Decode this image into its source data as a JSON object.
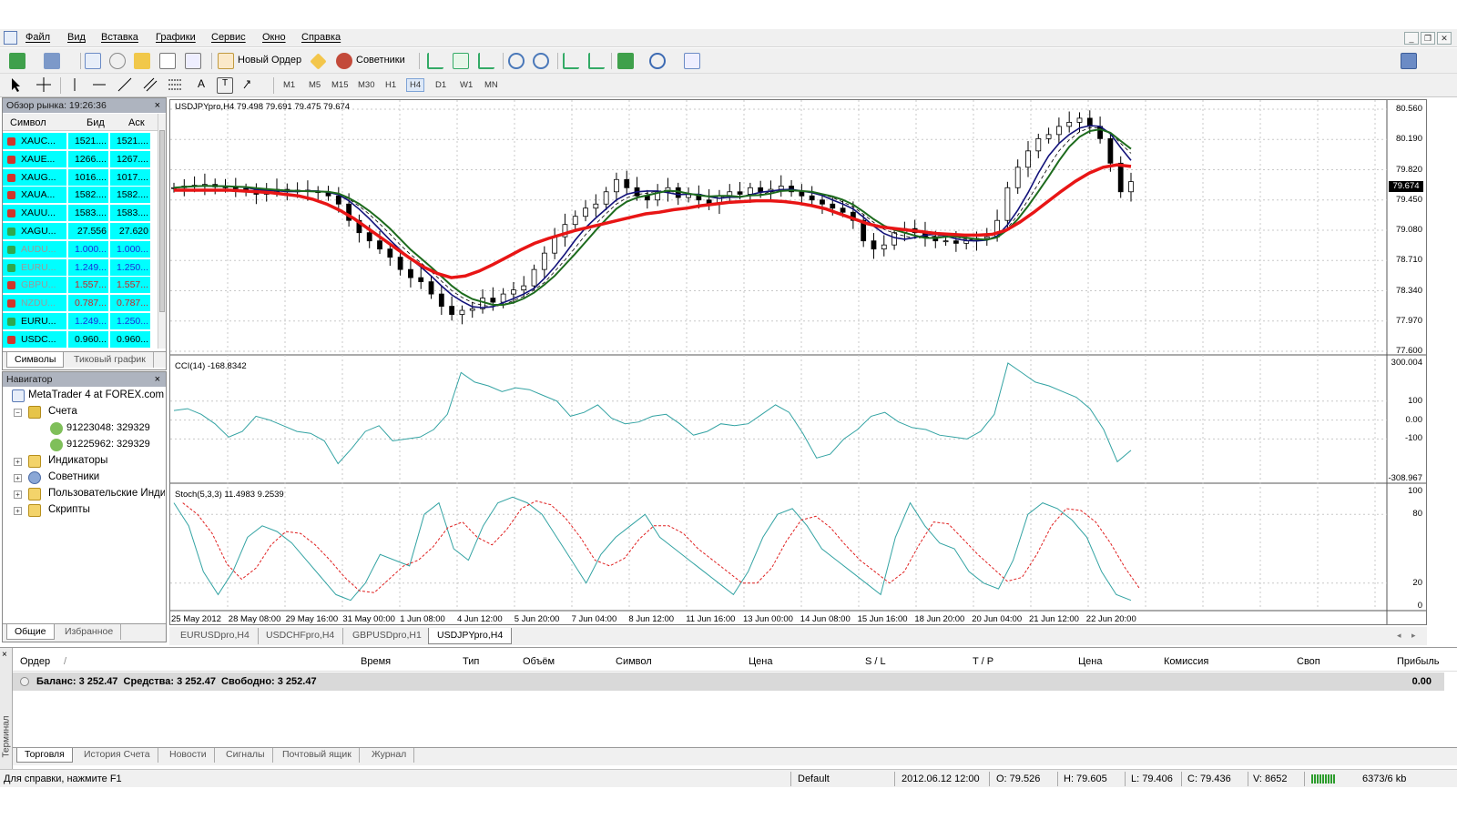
{
  "menu": [
    "Файл",
    "Вид",
    "Вставка",
    "Графики",
    "Сервис",
    "Окно",
    "Справка"
  ],
  "toolbar": {
    "new_order_label": "Новый Ордер",
    "experts_label": "Советники"
  },
  "timeframes": [
    "M1",
    "M5",
    "M15",
    "M30",
    "H1",
    "H4",
    "D1",
    "W1",
    "MN"
  ],
  "active_timeframe": "H4",
  "market_watch": {
    "title": "Обзор рынка: 19:26:36",
    "columns": [
      "Символ",
      "Бид",
      "Аск"
    ],
    "rows": [
      {
        "symbol": "XAUC...",
        "bid": "1521....",
        "ask": "1521....",
        "bg": "#00ffff",
        "dir": "down"
      },
      {
        "symbol": "XAUE...",
        "bid": "1266....",
        "ask": "1267....",
        "bg": "#00ffff",
        "dir": "down"
      },
      {
        "symbol": "XAUG...",
        "bid": "1016....",
        "ask": "1017....",
        "bg": "#00ffff",
        "dir": "down"
      },
      {
        "symbol": "XAUA...",
        "bid": "1582....",
        "ask": "1582....",
        "bg": "#00ffff",
        "dir": "down"
      },
      {
        "symbol": "XAUU...",
        "bid": "1583....",
        "ask": "1583....",
        "bg": "#00ffff",
        "dir": "down"
      },
      {
        "symbol": "XAGU...",
        "bid": "27.556",
        "ask": "27.620",
        "bg": "#00ffff",
        "dir": "up"
      },
      {
        "symbol": "AUDU...",
        "bid": "1.000...",
        "ask": "1.000...",
        "bg": "#00ffff",
        "dir": "up",
        "muted": true,
        "blue": true
      },
      {
        "symbol": "EURU...",
        "bid": "1.249...",
        "ask": "1.250...",
        "bg": "#00ffff",
        "dir": "up",
        "muted": true,
        "blue": true
      },
      {
        "symbol": "GBPU...",
        "bid": "1.557...",
        "ask": "1.557...",
        "bg": "#00ffff",
        "dir": "down",
        "muted": true,
        "red": true
      },
      {
        "symbol": "NZDU...",
        "bid": "0.787...",
        "ask": "0.787...",
        "bg": "#00ffff",
        "dir": "down",
        "muted": true,
        "red": true
      },
      {
        "symbol": "EURU...",
        "bid": "1.249...",
        "ask": "1.250...",
        "bg": "#00ffff",
        "dir": "up",
        "blue": true
      },
      {
        "symbol": "USDC...",
        "bid": "0.960...",
        "ask": "0.960...",
        "bg": "#00ffff",
        "dir": "down"
      }
    ],
    "tabs": [
      "Символы",
      "Тиковый график"
    ]
  },
  "navigator": {
    "title": "Навигатор",
    "root": "MetaTrader 4 at FOREX.com",
    "accounts_label": "Счета",
    "accounts": [
      "91223048: 329329",
      "91225962: 329329"
    ],
    "items": [
      "Индикаторы",
      "Советники",
      "Пользовательские Инди",
      "Скрипты"
    ],
    "tabs": [
      "Общие",
      "Избранное"
    ]
  },
  "chart": {
    "symbol_label": "USDJPYpro,H4  79.498 79.691 79.475 79.674",
    "current_price": "79.674",
    "price_ticks": [
      "80.560",
      "80.190",
      "79.820",
      "79.450",
      "79.080",
      "78.710",
      "78.340",
      "77.970",
      "77.600"
    ],
    "cci_label": "CCI(14) -168.8342",
    "cci_ticks": [
      "300.004",
      "100",
      "0.00",
      "-100",
      "-308.967"
    ],
    "stoch_label": "Stoch(5,3,3) 11.4983 9.2539",
    "stoch_ticks": [
      "100",
      "80",
      "20",
      "0"
    ],
    "dates": [
      "25 May 2012",
      "28 May 08:00",
      "29 May 16:00",
      "31 May 00:00",
      "1 Jun 08:00",
      "4 Jun 12:00",
      "5 Jun 20:00",
      "7 Jun 04:00",
      "8 Jun 12:00",
      "11 Jun 16:00",
      "13 Jun 00:00",
      "14 Jun 08:00",
      "15 Jun 16:00",
      "18 Jun 20:00",
      "20 Jun 04:00",
      "21 Jun 12:00",
      "22 Jun 20:00"
    ],
    "tabs": [
      "EURUSDpro,H4",
      "USDCHFpro,H4",
      "GBPUSDpro,H1",
      "USDJPYpro,H4"
    ],
    "active_tab": "USDJPYpro,H4"
  },
  "chart_data": {
    "type": "line",
    "title": "USDJPYpro,H4",
    "ylim": [
      77.6,
      80.56
    ],
    "close": [
      79.6,
      79.62,
      79.63,
      79.64,
      79.61,
      79.6,
      79.59,
      79.57,
      79.52,
      79.55,
      79.58,
      79.55,
      79.57,
      79.56,
      79.54,
      79.5,
      79.4,
      79.2,
      79.05,
      78.95,
      78.85,
      78.75,
      78.6,
      78.5,
      78.45,
      78.3,
      78.15,
      78.05,
      78.1,
      78.12,
      78.25,
      78.2,
      78.3,
      78.35,
      78.4,
      78.6,
      78.8,
      79.0,
      79.15,
      79.25,
      79.35,
      79.4,
      79.55,
      79.7,
      79.6,
      79.5,
      79.45,
      79.55,
      79.6,
      79.48,
      79.52,
      79.45,
      79.4,
      79.5,
      79.55,
      79.52,
      79.6,
      79.55,
      79.58,
      79.62,
      79.55,
      79.5,
      79.45,
      79.4,
      79.35,
      79.3,
      79.2,
      78.95,
      78.85,
      78.9,
      79.05,
      79.1,
      79.05,
      79.0,
      78.95,
      78.95,
      78.92,
      78.95,
      78.98,
      79.0,
      79.2,
      79.6,
      79.85,
      80.05,
      80.2,
      80.25,
      80.35,
      80.4,
      80.45,
      80.35,
      80.2,
      79.9,
      79.55,
      79.674
    ],
    "ma_red": [
      79.57,
      79.57,
      79.57,
      79.57,
      79.57,
      79.56,
      79.55,
      79.54,
      79.52,
      79.5,
      79.46,
      79.4,
      79.32,
      79.22,
      79.1,
      78.98,
      78.86,
      78.74,
      78.63,
      78.55,
      78.5,
      78.52,
      78.58,
      78.66,
      78.75,
      78.84,
      78.92,
      78.98,
      79.03,
      79.08,
      79.12,
      79.16,
      79.2,
      79.24,
      79.28,
      79.3,
      79.33,
      79.35,
      79.38,
      79.4,
      79.42,
      79.43,
      79.44,
      79.44,
      79.43,
      79.41,
      79.38,
      79.34,
      79.28,
      79.22,
      79.16,
      79.12,
      79.1,
      79.08,
      79.06,
      79.04,
      79.03,
      79.02,
      79.02,
      79.03,
      79.08,
      79.18,
      79.3,
      79.43,
      79.56,
      79.68,
      79.78,
      79.85,
      79.88,
      79.86
    ],
    "cci": [
      50,
      60,
      30,
      -20,
      -90,
      -60,
      20,
      0,
      -30,
      -60,
      -70,
      -110,
      -230,
      -150,
      -60,
      -30,
      -110,
      -100,
      -90,
      -50,
      30,
      250,
      200,
      180,
      150,
      170,
      160,
      130,
      100,
      20,
      40,
      80,
      10,
      -20,
      -10,
      20,
      30,
      -20,
      -80,
      -60,
      -20,
      -30,
      -20,
      30,
      80,
      40,
      -70,
      -200,
      -180,
      -100,
      -50,
      20,
      40,
      -10,
      -40,
      -50,
      -80,
      -90,
      -100,
      -60,
      30,
      300,
      250,
      200,
      180,
      150,
      120,
      60,
      -50,
      -220,
      -160
    ],
    "stoch": [
      90,
      70,
      30,
      10,
      30,
      60,
      70,
      65,
      55,
      40,
      25,
      10,
      5,
      20,
      45,
      40,
      35,
      80,
      90,
      50,
      40,
      70,
      90,
      95,
      90,
      80,
      60,
      40,
      20,
      45,
      60,
      70,
      80,
      60,
      50,
      40,
      30,
      20,
      10,
      30,
      60,
      80,
      85,
      70,
      50,
      40,
      30,
      20,
      10,
      60,
      90,
      70,
      55,
      50,
      30,
      20,
      15,
      40,
      80,
      90,
      85,
      75,
      60,
      30,
      10,
      5
    ]
  },
  "terminal": {
    "side_label": "Терминал",
    "columns": [
      "Ордер",
      "Время",
      "Тип",
      "Объём",
      "Символ",
      "Цена",
      "S / L",
      "T / P",
      "Цена",
      "Комиссия",
      "Своп",
      "Прибыль"
    ],
    "balance_line": "Баланс: 3 252.47  Средства: 3 252.47  Свободно: 3 252.47",
    "balance_profit": "0.00",
    "tabs": [
      "Торговля",
      "История Счета",
      "Новости",
      "Сигналы",
      "Почтовый ящик",
      "Журнал"
    ]
  },
  "status": {
    "help": "Для справки, нажмите F1",
    "profile": "Default",
    "datetime": "2012.06.12 12:00",
    "open": "O: 79.526",
    "high": "H: 79.605",
    "low": "L: 79.406",
    "close": "C: 79.436",
    "volume": "V: 8652",
    "traffic": "6373/6 kb"
  }
}
